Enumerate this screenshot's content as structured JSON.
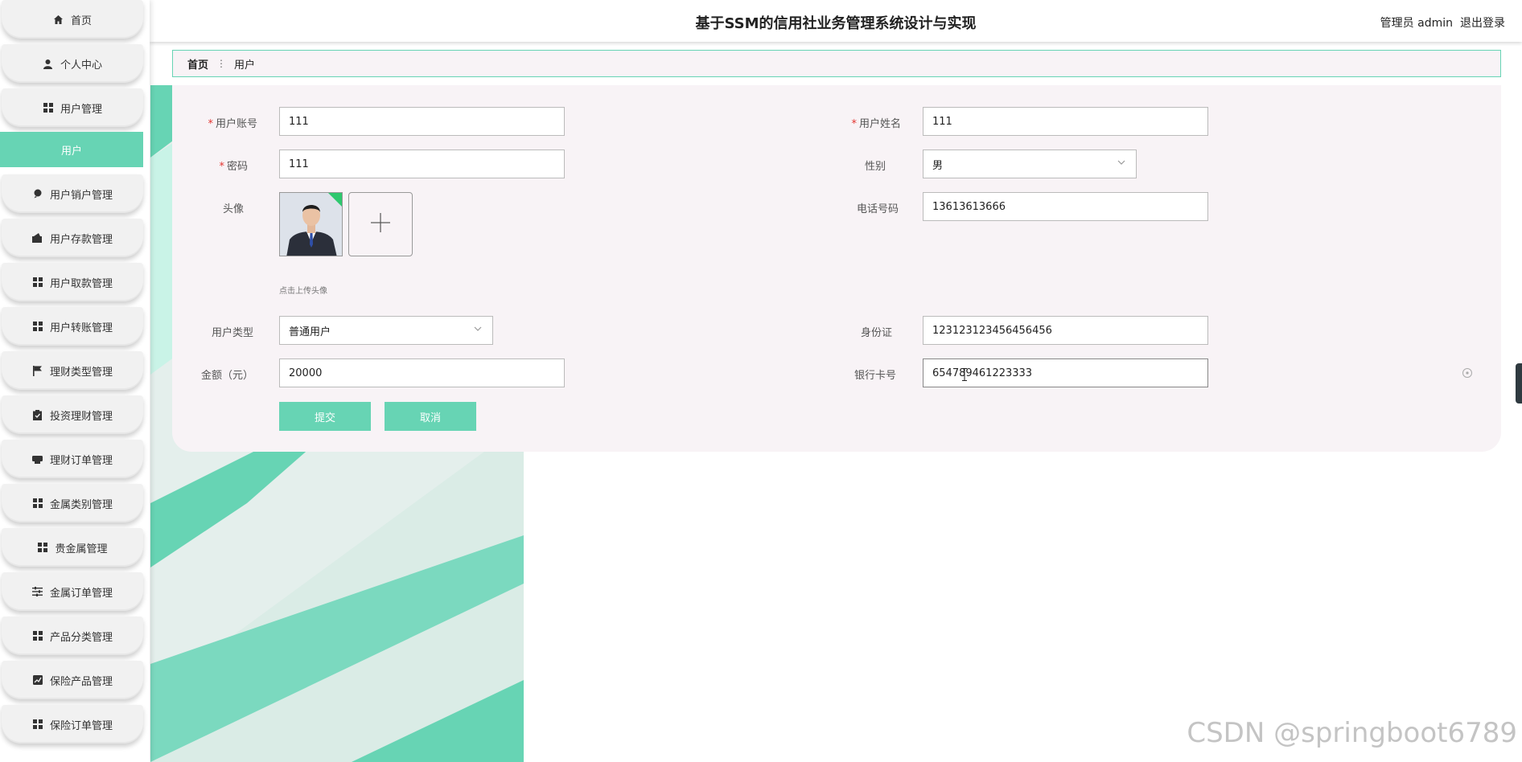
{
  "header": {
    "title": "基于SSM的信用社业务管理系统设计与实现",
    "admin_label": "管理员 admin",
    "logout": "退出登录"
  },
  "sidebar": {
    "items": [
      {
        "label": "首页",
        "icon": "home-icon"
      },
      {
        "label": "个人中心",
        "icon": "user-icon"
      },
      {
        "label": "用户管理",
        "icon": "grid-icon"
      },
      {
        "label": "用户",
        "icon": "",
        "active": true
      },
      {
        "label": "用户销户管理",
        "icon": "pin-icon"
      },
      {
        "label": "用户存款管理",
        "icon": "wallet-icon"
      },
      {
        "label": "用户取款管理",
        "icon": "grid-icon"
      },
      {
        "label": "用户转账管理",
        "icon": "grid-icon"
      },
      {
        "label": "理财类型管理",
        "icon": "flag-icon"
      },
      {
        "label": "投资理财管理",
        "icon": "clipboard-icon"
      },
      {
        "label": "理财订单管理",
        "icon": "printer-icon"
      },
      {
        "label": "金属类别管理",
        "icon": "grid-icon"
      },
      {
        "label": "贵金属管理",
        "icon": "grid-icon"
      },
      {
        "label": "金属订单管理",
        "icon": "sliders-icon"
      },
      {
        "label": "产品分类管理",
        "icon": "grid-icon"
      },
      {
        "label": "保险产品管理",
        "icon": "chart-icon"
      },
      {
        "label": "保险订单管理",
        "icon": "grid-icon"
      }
    ]
  },
  "breadcrumb": {
    "home": "首页",
    "current": "用户"
  },
  "form": {
    "account_label": "用户账号",
    "account_value": "111",
    "name_label": "用户姓名",
    "name_value": "111",
    "password_label": "密码",
    "password_value": "111",
    "gender_label": "性别",
    "gender_value": "男",
    "avatar_label": "头像",
    "phone_label": "电话号码",
    "phone_value": "13613613666",
    "upload_hint": "点击上传头像",
    "type_label": "用户类型",
    "type_value": "普通用户",
    "id_label": "身份证",
    "id_value": "123123123456456456",
    "amount_label": "金额（元）",
    "amount_value": "20000",
    "card_label": "银行卡号",
    "card_value": "654789461223333",
    "submit": "提交",
    "cancel": "取消"
  },
  "colors": {
    "accent": "#67d4b4",
    "card_bg": "#f8f3f6",
    "required": "#e3342f"
  },
  "watermark": "CSDN @springboot6789"
}
